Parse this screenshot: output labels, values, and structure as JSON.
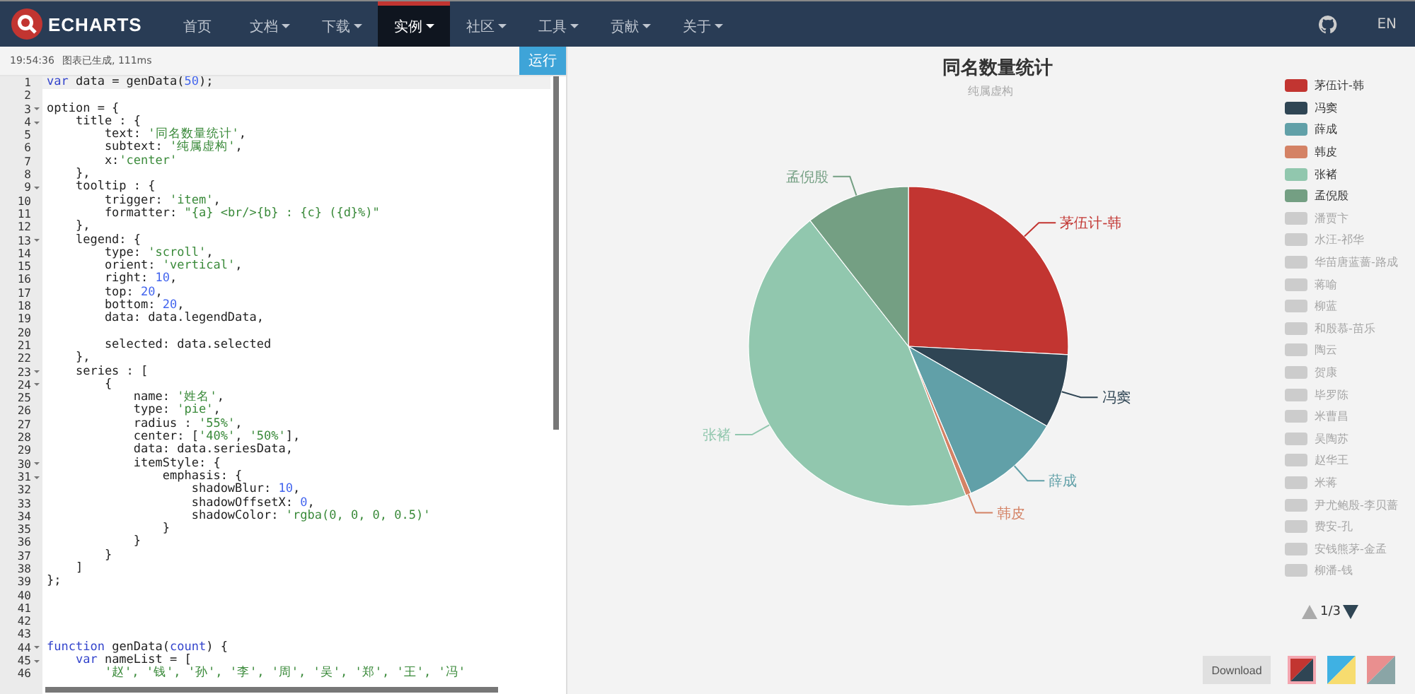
{
  "nav": {
    "brand": "ECHARTS",
    "items": [
      {
        "label": "首页",
        "selected": false,
        "dropdown": false
      },
      {
        "label": "文档",
        "selected": false,
        "dropdown": true
      },
      {
        "label": "下载",
        "selected": false,
        "dropdown": true
      },
      {
        "label": "实例",
        "selected": true,
        "dropdown": true
      },
      {
        "label": "社区",
        "selected": false,
        "dropdown": true
      },
      {
        "label": "工具",
        "selected": false,
        "dropdown": true
      },
      {
        "label": "贡献",
        "selected": false,
        "dropdown": true
      },
      {
        "label": "关于",
        "selected": false,
        "dropdown": true
      }
    ],
    "language": "EN"
  },
  "toolbar": {
    "time": "19:54:36",
    "status": "图表已生成, 111ms",
    "run_button": "运行"
  },
  "editor": {
    "lines": [
      {
        "num": "1",
        "fold": false,
        "active": true,
        "parts": [
          {
            "kind": "keyword",
            "text": "var"
          },
          {
            "kind": "plain",
            "text": " data = genData("
          },
          {
            "kind": "number",
            "text": "50"
          },
          {
            "kind": "plain",
            "text": ");"
          }
        ]
      },
      {
        "num": "2",
        "fold": false,
        "active": false
      },
      {
        "num": "3",
        "fold": true,
        "active": false,
        "parts": [
          {
            "kind": "plain",
            "text": "option = {"
          }
        ]
      },
      {
        "num": "4",
        "fold": true,
        "active": false,
        "parts": [
          {
            "kind": "plain",
            "text": "    title : {"
          }
        ]
      },
      {
        "num": "5",
        "fold": false,
        "active": false,
        "parts": [
          {
            "kind": "plain",
            "text": "        text: "
          },
          {
            "kind": "string",
            "text": "'同名数量统计'"
          },
          {
            "kind": "plain",
            "text": ","
          }
        ]
      },
      {
        "num": "6",
        "fold": false,
        "active": false,
        "parts": [
          {
            "kind": "plain",
            "text": "        subtext: "
          },
          {
            "kind": "string",
            "text": "'纯属虚构'"
          },
          {
            "kind": "plain",
            "text": ","
          }
        ]
      },
      {
        "num": "7",
        "fold": false,
        "active": false,
        "parts": [
          {
            "kind": "plain",
            "text": "        x:"
          },
          {
            "kind": "string",
            "text": "'center'"
          }
        ]
      },
      {
        "num": "8",
        "fold": false,
        "active": false,
        "parts": [
          {
            "kind": "plain",
            "text": "    },"
          }
        ]
      },
      {
        "num": "9",
        "fold": true,
        "active": false,
        "parts": [
          {
            "kind": "plain",
            "text": "    tooltip : {"
          }
        ]
      },
      {
        "num": "10",
        "fold": false,
        "active": false,
        "parts": [
          {
            "kind": "plain",
            "text": "        trigger: "
          },
          {
            "kind": "string",
            "text": "'item'"
          },
          {
            "kind": "plain",
            "text": ","
          }
        ]
      },
      {
        "num": "11",
        "fold": false,
        "active": false,
        "parts": [
          {
            "kind": "plain",
            "text": "        formatter: "
          },
          {
            "kind": "string",
            "text": "\"{a} <br/>{b} : {c} ({d}%)\""
          }
        ]
      },
      {
        "num": "12",
        "fold": false,
        "active": false,
        "parts": [
          {
            "kind": "plain",
            "text": "    },"
          }
        ]
      },
      {
        "num": "13",
        "fold": true,
        "active": false,
        "parts": [
          {
            "kind": "plain",
            "text": "    legend: {"
          }
        ]
      },
      {
        "num": "14",
        "fold": false,
        "active": false,
        "parts": [
          {
            "kind": "plain",
            "text": "        type: "
          },
          {
            "kind": "string",
            "text": "'scroll'"
          },
          {
            "kind": "plain",
            "text": ","
          }
        ]
      },
      {
        "num": "15",
        "fold": false,
        "active": false,
        "parts": [
          {
            "kind": "plain",
            "text": "        orient: "
          },
          {
            "kind": "string",
            "text": "'vertical'"
          },
          {
            "kind": "plain",
            "text": ","
          }
        ]
      },
      {
        "num": "16",
        "fold": false,
        "active": false,
        "parts": [
          {
            "kind": "plain",
            "text": "        right: "
          },
          {
            "kind": "number",
            "text": "10"
          },
          {
            "kind": "plain",
            "text": ","
          }
        ]
      },
      {
        "num": "17",
        "fold": false,
        "active": false,
        "parts": [
          {
            "kind": "plain",
            "text": "        top: "
          },
          {
            "kind": "number",
            "text": "20"
          },
          {
            "kind": "plain",
            "text": ","
          }
        ]
      },
      {
        "num": "18",
        "fold": false,
        "active": false,
        "parts": [
          {
            "kind": "plain",
            "text": "        bottom: "
          },
          {
            "kind": "number",
            "text": "20"
          },
          {
            "kind": "plain",
            "text": ","
          }
        ]
      },
      {
        "num": "19",
        "fold": false,
        "active": false,
        "parts": [
          {
            "kind": "plain",
            "text": "        data: data.legendData,"
          }
        ]
      },
      {
        "num": "20",
        "fold": false,
        "active": false
      },
      {
        "num": "21",
        "fold": false,
        "active": false,
        "parts": [
          {
            "kind": "plain",
            "text": "        selected: data.selected"
          }
        ]
      },
      {
        "num": "22",
        "fold": false,
        "active": false,
        "parts": [
          {
            "kind": "plain",
            "text": "    },"
          }
        ]
      },
      {
        "num": "23",
        "fold": true,
        "active": false,
        "parts": [
          {
            "kind": "plain",
            "text": "    series : ["
          }
        ]
      },
      {
        "num": "24",
        "fold": true,
        "active": false,
        "parts": [
          {
            "kind": "plain",
            "text": "        {"
          }
        ]
      },
      {
        "num": "25",
        "fold": false,
        "active": false,
        "parts": [
          {
            "kind": "plain",
            "text": "            name: "
          },
          {
            "kind": "string",
            "text": "'姓名'"
          },
          {
            "kind": "plain",
            "text": ","
          }
        ]
      },
      {
        "num": "26",
        "fold": false,
        "active": false,
        "parts": [
          {
            "kind": "plain",
            "text": "            type: "
          },
          {
            "kind": "string",
            "text": "'pie'"
          },
          {
            "kind": "plain",
            "text": ","
          }
        ]
      },
      {
        "num": "27",
        "fold": false,
        "active": false,
        "parts": [
          {
            "kind": "plain",
            "text": "            radius : "
          },
          {
            "kind": "string",
            "text": "'55%'"
          },
          {
            "kind": "plain",
            "text": ","
          }
        ]
      },
      {
        "num": "28",
        "fold": false,
        "active": false,
        "parts": [
          {
            "kind": "plain",
            "text": "            center: ["
          },
          {
            "kind": "string",
            "text": "'40%'"
          },
          {
            "kind": "plain",
            "text": ", "
          },
          {
            "kind": "string",
            "text": "'50%'"
          },
          {
            "kind": "plain",
            "text": "],"
          }
        ]
      },
      {
        "num": "29",
        "fold": false,
        "active": false,
        "parts": [
          {
            "kind": "plain",
            "text": "            data: data.seriesData,"
          }
        ]
      },
      {
        "num": "30",
        "fold": true,
        "active": false,
        "parts": [
          {
            "kind": "plain",
            "text": "            itemStyle: {"
          }
        ]
      },
      {
        "num": "31",
        "fold": true,
        "active": false,
        "parts": [
          {
            "kind": "plain",
            "text": "                emphasis: {"
          }
        ]
      },
      {
        "num": "32",
        "fold": false,
        "active": false,
        "parts": [
          {
            "kind": "plain",
            "text": "                    shadowBlur: "
          },
          {
            "kind": "number",
            "text": "10"
          },
          {
            "kind": "plain",
            "text": ","
          }
        ]
      },
      {
        "num": "33",
        "fold": false,
        "active": false,
        "parts": [
          {
            "kind": "plain",
            "text": "                    shadowOffsetX: "
          },
          {
            "kind": "number",
            "text": "0"
          },
          {
            "kind": "plain",
            "text": ","
          }
        ]
      },
      {
        "num": "34",
        "fold": false,
        "active": false,
        "parts": [
          {
            "kind": "plain",
            "text": "                    shadowColor: "
          },
          {
            "kind": "string",
            "text": "'rgba(0, 0, 0, 0.5)'"
          }
        ]
      },
      {
        "num": "35",
        "fold": false,
        "active": false,
        "parts": [
          {
            "kind": "plain",
            "text": "                }"
          }
        ]
      },
      {
        "num": "36",
        "fold": false,
        "active": false,
        "parts": [
          {
            "kind": "plain",
            "text": "            }"
          }
        ]
      },
      {
        "num": "37",
        "fold": false,
        "active": false,
        "parts": [
          {
            "kind": "plain",
            "text": "        }"
          }
        ]
      },
      {
        "num": "38",
        "fold": false,
        "active": false,
        "parts": [
          {
            "kind": "plain",
            "text": "    ]"
          }
        ]
      },
      {
        "num": "39",
        "fold": false,
        "active": false,
        "parts": [
          {
            "kind": "plain",
            "text": "};"
          }
        ]
      },
      {
        "num": "40",
        "fold": false,
        "active": false
      },
      {
        "num": "41",
        "fold": false,
        "active": false
      },
      {
        "num": "42",
        "fold": false,
        "active": false
      },
      {
        "num": "43",
        "fold": false,
        "active": false
      },
      {
        "num": "44",
        "fold": true,
        "active": false,
        "parts": [
          {
            "kind": "keyword",
            "text": "function"
          },
          {
            "kind": "plain",
            "text": " genData("
          },
          {
            "kind": "keyword",
            "text": "count"
          },
          {
            "kind": "plain",
            "text": ") {"
          }
        ]
      },
      {
        "num": "45",
        "fold": true,
        "active": false,
        "parts": [
          {
            "kind": "keyword",
            "text": "    var"
          },
          {
            "kind": "plain",
            "text": " nameList = ["
          }
        ]
      },
      {
        "num": "46",
        "fold": false,
        "active": false,
        "parts": [
          {
            "kind": "string",
            "text": "        '赵', '钱', '孙', '李', '周', '吴', '郑', '王', '冯'"
          }
        ]
      }
    ]
  },
  "chart": {
    "title": "同名数量统计",
    "subtitle": "纯属虚构",
    "slices": [
      {
        "label": "茅伍计-韩",
        "color": "#c23531"
      },
      {
        "label": "冯窦",
        "color": "#2f4554"
      },
      {
        "label": "薛成",
        "color": "#61a0a8"
      },
      {
        "label": "韩皮",
        "color": "#d48265"
      },
      {
        "label": "张褚",
        "color": "#91c7ae"
      },
      {
        "label": "孟倪殷",
        "color": "#749f83"
      }
    ],
    "legend": [
      {
        "name": "茅伍计-韩",
        "color": "#c23531",
        "selected": true
      },
      {
        "name": "冯窦",
        "color": "#2f4554",
        "selected": true
      },
      {
        "name": "薛成",
        "color": "#61a0a8",
        "selected": true
      },
      {
        "name": "韩皮",
        "color": "#d48265",
        "selected": true
      },
      {
        "name": "张褚",
        "color": "#91c7ae",
        "selected": true
      },
      {
        "name": "孟倪殷",
        "color": "#749f83",
        "selected": true
      },
      {
        "name": "潘贾卞",
        "selected": false
      },
      {
        "name": "水汪-祁华",
        "selected": false
      },
      {
        "name": "华苗唐蓝蔷-路成",
        "selected": false
      },
      {
        "name": "蒋喻",
        "selected": false
      },
      {
        "name": "柳蓝",
        "selected": false
      },
      {
        "name": "和殷慕-苗乐",
        "selected": false
      },
      {
        "name": "陶云",
        "selected": false
      },
      {
        "name": "贺康",
        "selected": false
      },
      {
        "name": "毕罗陈",
        "selected": false
      },
      {
        "name": "米曹昌",
        "selected": false
      },
      {
        "name": "吴陶苏",
        "selected": false
      },
      {
        "name": "赵华王",
        "selected": false
      },
      {
        "name": "米蒋",
        "selected": false
      },
      {
        "name": "尹尤鲍殷-李贝蔷",
        "selected": false
      },
      {
        "name": "费安-孔",
        "selected": false
      },
      {
        "name": "安钱熊茅-金孟",
        "selected": false
      },
      {
        "name": "柳潘-钱",
        "selected": false
      }
    ],
    "pager": "1/3",
    "download_button": "Download",
    "themes": [
      {
        "selected": true
      },
      {
        "selected": false
      },
      {
        "selected": false
      }
    ]
  }
}
